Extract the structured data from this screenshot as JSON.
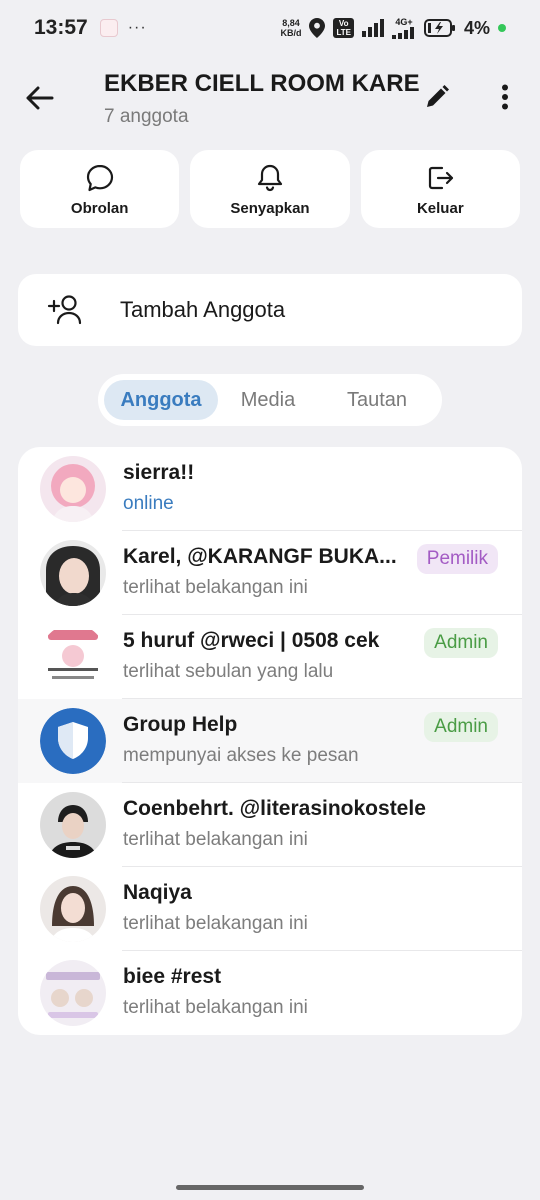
{
  "status_bar": {
    "time": "13:57",
    "more": "···",
    "net_speed_value": "8,84",
    "net_speed_unit": "KB/d",
    "volte_top": "Vo",
    "volte_bottom": "LTE",
    "network": "4G+",
    "battery_pct": "4%"
  },
  "header": {
    "title": "EKBER CIELL ROOM KAREL",
    "members_count": "7 anggota"
  },
  "actions": [
    {
      "label": "Obrolan",
      "icon": "chat-bubble-icon"
    },
    {
      "label": "Senyapkan",
      "icon": "bell-icon"
    },
    {
      "label": "Keluar",
      "icon": "exit-icon"
    }
  ],
  "add_member": {
    "label": "Tambah Anggota",
    "icon": "add-person-icon"
  },
  "tabs": [
    {
      "label": "Anggota",
      "active": true
    },
    {
      "label": "Media",
      "active": false
    },
    {
      "label": "Tautan",
      "active": false
    }
  ],
  "members": [
    {
      "name": "sierra!!",
      "status": "online",
      "role": ""
    },
    {
      "name": "Karel, @KARANGF BUKA...",
      "status": "terlihat belakangan ini",
      "role": "Pemilik"
    },
    {
      "name": "5 huruf @rweci | 0508 cek",
      "status": "terlihat sebulan yang lalu",
      "role": "Admin"
    },
    {
      "name": "Group Help",
      "status": "mempunyai akses ke pesan",
      "role": "Admin"
    },
    {
      "name": "Coenbehrt. @literasinokostele",
      "status": "terlihat belakangan ini",
      "role": ""
    },
    {
      "name": "Naqiya",
      "status": "terlihat belakangan ini",
      "role": ""
    },
    {
      "name": "biee #rest",
      "status": "terlihat belakangan ini",
      "role": ""
    }
  ],
  "colors": {
    "accent": "#3a7cbf",
    "owner_badge": "#a35bc4",
    "admin_badge": "#4a9c45",
    "background": "#f0f0f3"
  }
}
